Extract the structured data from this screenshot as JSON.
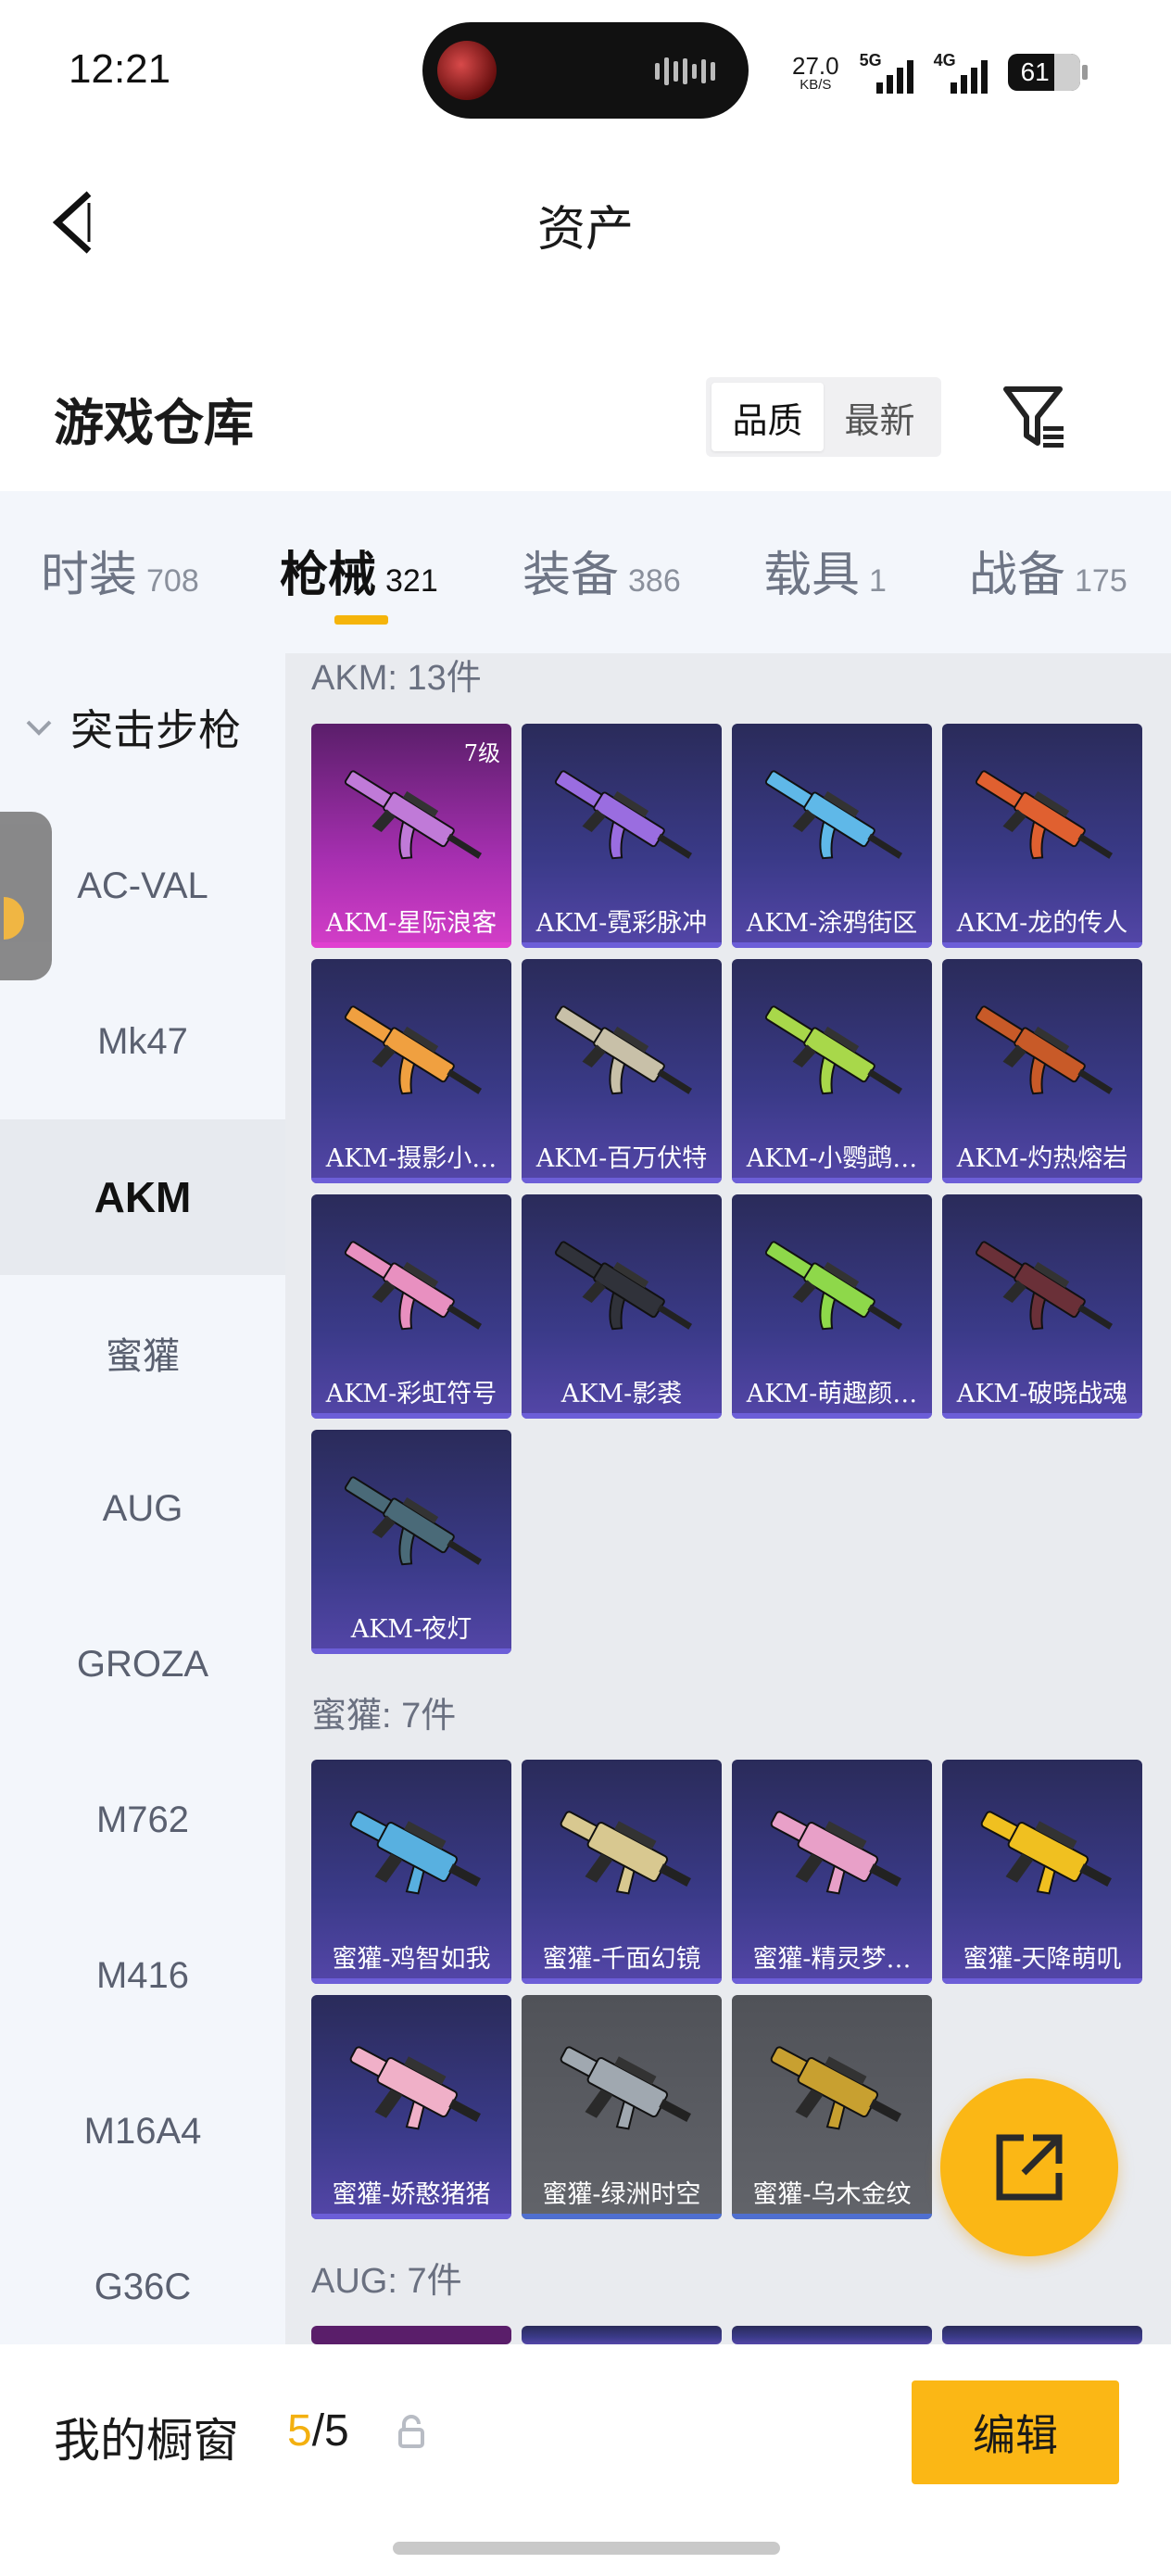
{
  "status_bar": {
    "time": "12:21",
    "speed_value": "27.0",
    "speed_unit": "KB/S",
    "net1": "5G",
    "net2": "4G",
    "battery": "61"
  },
  "header": {
    "title": "资产"
  },
  "section": {
    "title": "游戏仓库",
    "sort_options": [
      "品质",
      "最新"
    ],
    "active_sort": "品质"
  },
  "tabs": [
    {
      "label": "时装",
      "count": "708"
    },
    {
      "label": "枪械",
      "count": "321"
    },
    {
      "label": "装备",
      "count": "386"
    },
    {
      "label": "载具",
      "count": "1"
    },
    {
      "label": "战备",
      "count": "175"
    }
  ],
  "active_tab": "枪械",
  "sidebar": {
    "category": "突击步枪",
    "items": [
      "AC-VAL",
      "Mk47",
      "AKM",
      "蜜獾",
      "AUG",
      "GROZA",
      "M762",
      "M416",
      "M16A4",
      "G36C"
    ],
    "active": "AKM"
  },
  "groups": [
    {
      "title": "AKM: 13件",
      "items": [
        {
          "name": "AKM-星际浪客",
          "level": "7级",
          "rarity": "pink",
          "color": "#c07ad8"
        },
        {
          "name": "AKM-霓彩脉冲",
          "rarity": "purple",
          "color": "#9a6de0"
        },
        {
          "name": "AKM-涂鸦街区",
          "rarity": "purple",
          "color": "#5fb8e8"
        },
        {
          "name": "AKM-龙的传人",
          "rarity": "purple",
          "color": "#e06030"
        },
        {
          "name": "AKM-摄影小…",
          "rarity": "purple",
          "color": "#f0a040"
        },
        {
          "name": "AKM-百万伏特",
          "rarity": "purple",
          "color": "#c8c0a8"
        },
        {
          "name": "AKM-小鹦鹉…",
          "rarity": "purple",
          "color": "#a8d84a"
        },
        {
          "name": "AKM-灼热熔岩",
          "rarity": "purple",
          "color": "#c85a28"
        },
        {
          "name": "AKM-彩虹符号",
          "rarity": "purple",
          "color": "#e890c0"
        },
        {
          "name": "AKM-影裘",
          "rarity": "purple",
          "color": "#30323a"
        },
        {
          "name": "AKM-萌趣颜…",
          "rarity": "purple",
          "color": "#8ed84a"
        },
        {
          "name": "AKM-破晓战魂",
          "rarity": "purple",
          "color": "#6a3038"
        },
        {
          "name": "AKM-夜灯",
          "rarity": "purple",
          "color": "#4a6a78"
        }
      ]
    },
    {
      "title": "蜜獾: 7件",
      "items": [
        {
          "name": "蜜獾-鸡智如我",
          "rarity": "purple",
          "color": "#58b0e0"
        },
        {
          "name": "蜜獾-千面幻镜",
          "rarity": "purple",
          "color": "#d8c890"
        },
        {
          "name": "蜜獾-精灵梦…",
          "rarity": "purple",
          "color": "#e8a0c8"
        },
        {
          "name": "蜜獾-天降萌叽",
          "rarity": "purple",
          "color": "#f0c020"
        },
        {
          "name": "蜜獾-娇憨猪猪",
          "rarity": "purple",
          "color": "#f0b0c8"
        },
        {
          "name": "蜜獾-绿洲时空",
          "rarity": "gray",
          "color": "#a0a8b0"
        },
        {
          "name": "蜜獾-乌木金纹",
          "rarity": "gray",
          "color": "#c8a030"
        }
      ]
    },
    {
      "title": "AUG: 7件",
      "items": []
    }
  ],
  "bottom_bar": {
    "label": "我的橱窗",
    "count_current": "5",
    "count_total": "/5",
    "edit_label": "编辑"
  },
  "colors": {
    "accent": "#fbb715",
    "panel": "#f3f6fb"
  }
}
